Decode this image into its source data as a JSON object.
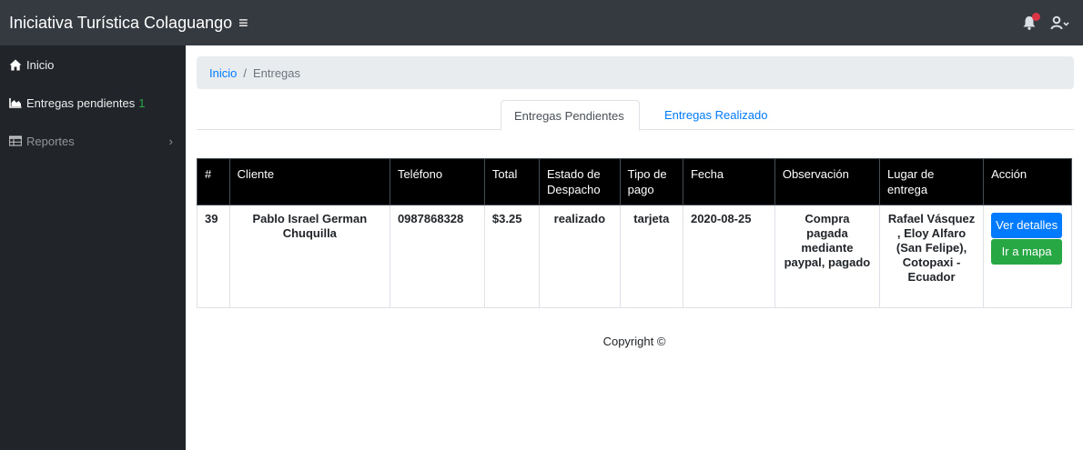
{
  "app": {
    "title": "Iniciativa Turística Colaguango"
  },
  "icons": {
    "menu": "bars-icon",
    "bell": "bell-icon",
    "user": "user-icon",
    "home": "home-icon",
    "chart": "chart-area-icon",
    "table": "table-icon",
    "chevron": "chevron-right-icon"
  },
  "colors": {
    "topbar": "#343a40",
    "sidebar": "#212529",
    "accent": "#007bff",
    "success": "#28a745",
    "danger": "#dc3545"
  },
  "sidebar": {
    "items": [
      {
        "label": "Inicio"
      },
      {
        "label": "Entregas pendientes",
        "count": "1"
      },
      {
        "label": "Reportes"
      }
    ]
  },
  "breadcrumb": {
    "home": "Inicio",
    "separator": "/",
    "current": "Entregas"
  },
  "tabs": [
    {
      "label": "Entregas Pendientes",
      "active": true
    },
    {
      "label": "Entregas Realizado",
      "active": false
    }
  ],
  "table": {
    "headers": [
      "#",
      "Cliente",
      "Teléfono",
      "Total",
      "Estado de Despacho",
      "Tipo de pago",
      "Fecha",
      "Observación",
      "Lugar de entrega",
      "Acción"
    ],
    "rows": [
      {
        "id": "39",
        "cliente": "Pablo Israel German Chuquilla",
        "telefono": "0987868328",
        "total": "$3.25",
        "estado": "realizado",
        "tipo_pago": "tarjeta",
        "fecha": "2020-08-25",
        "observacion": "Compra pagada mediante paypal, pagado",
        "lugar": "Rafael Vásquez , Eloy Alfaro (San Felipe), Cotopaxi - Ecuador",
        "btn_detalles": "Ver detalles",
        "btn_mapa": "Ir a mapa"
      }
    ]
  },
  "footer": {
    "text": "Copyright ©"
  }
}
